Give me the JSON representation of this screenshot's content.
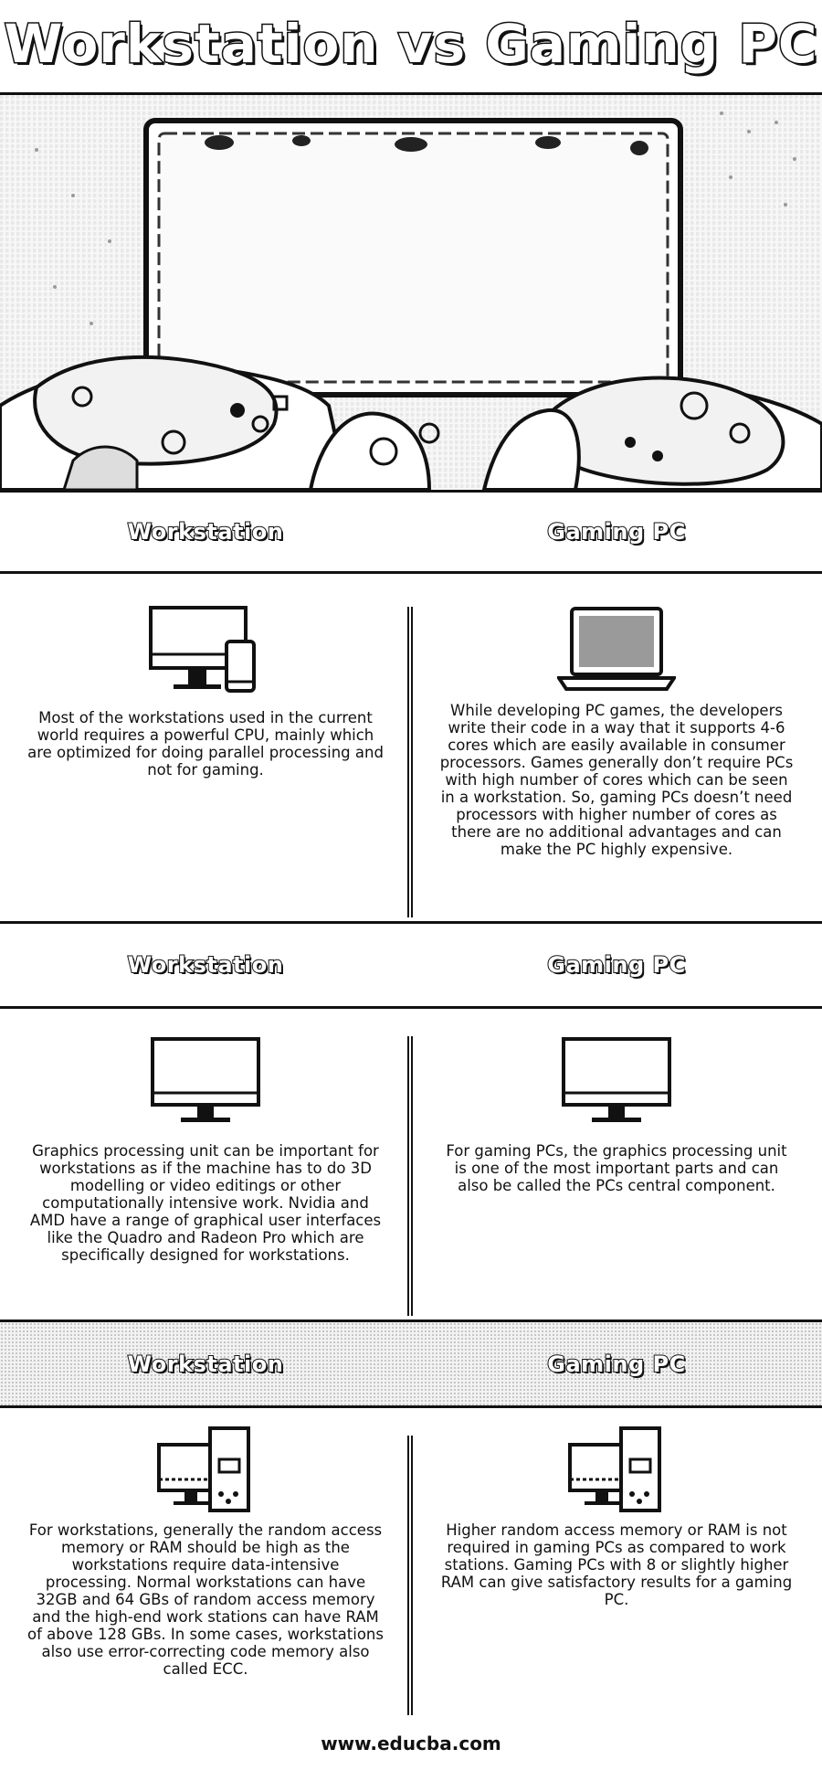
{
  "title": "Workstation vs Gaming PC",
  "column_headers": {
    "left": "Workstation",
    "right": "Gaming PC"
  },
  "sections": [
    {
      "left_icon": "desktop-and-phone-icon",
      "right_icon": "laptop-icon",
      "left_text": "Most of the workstations used in the current world requires a powerful CPU, mainly which are optimized for doing parallel processing and not for gaming.",
      "right_text": "While developing PC games, the developers write their code in a way that it supports 4-6 cores which are easily available in consumer processors. Games generally don’t require PCs with high number of cores which can be seen in a workstation. So, gaming PCs doesn’t need processors with higher number of cores as there are no additional advantages and can make the PC highly expensive."
    },
    {
      "left_icon": "monitor-icon",
      "right_icon": "monitor-icon",
      "left_text": "Graphics processing unit can be important for workstations as if the machine has to do 3D modelling or video editings or other computationally intensive work. Nvidia and AMD have a range of graphical user interfaces like the Quadro and Radeon Pro which are specifically designed for workstations.",
      "right_text": "For gaming PCs, the graphics processing unit is one of the most important parts and can also be called the PCs central component."
    },
    {
      "left_icon": "desktop-tower-icon",
      "right_icon": "desktop-tower-icon",
      "left_text": "For workstations, generally the random access memory or RAM should be high as the workstations require data-intensive processing. Normal workstations can have 32GB and 64 GBs of random access memory and the high-end work stations can have RAM of above 128 GBs. In some cases, workstations also use error-correcting code memory also called ECC.",
      "right_text": "Higher random access memory or RAM is not required in gaming PCs as compared to work stations. Gaming PCs with 8 or slightly higher RAM can give satisfactory results for a gaming PC."
    }
  ],
  "hero_image": "hands-holding-game-controllers-in-front-of-monitor",
  "footer": "www.educba.com"
}
